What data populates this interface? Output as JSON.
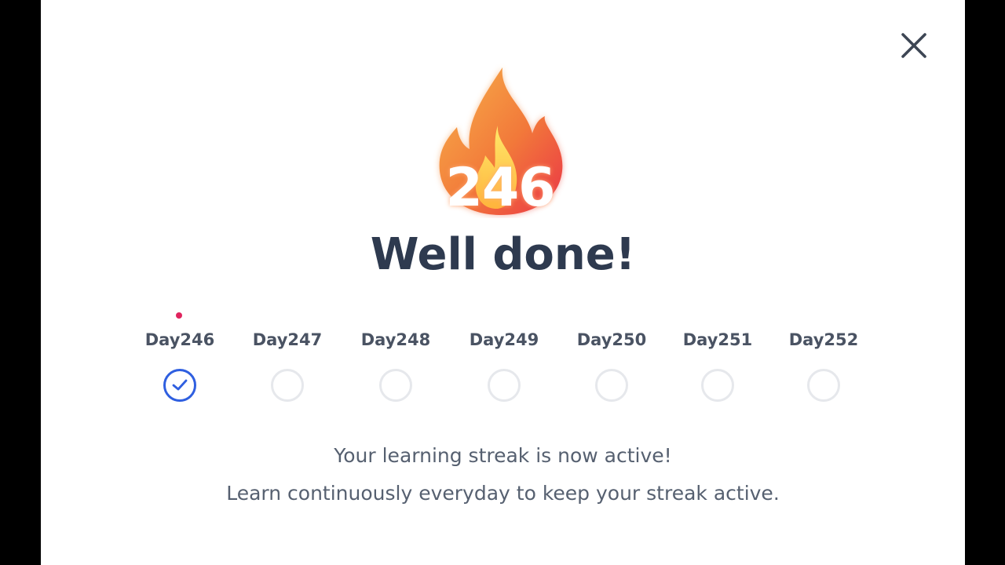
{
  "modal": {
    "streak_count": "246",
    "title": "Well done!",
    "message_line1": "Your learning streak is now active!",
    "message_line2": "Learn continuously everyday to keep your streak active.",
    "close_icon": "close-icon",
    "flame_icon": "flame-icon"
  },
  "days": [
    {
      "label": "Day246",
      "completed": true
    },
    {
      "label": "Day247",
      "completed": false
    },
    {
      "label": "Day248",
      "completed": false
    },
    {
      "label": "Day249",
      "completed": false
    },
    {
      "label": "Day250",
      "completed": false
    },
    {
      "label": "Day251",
      "completed": false
    },
    {
      "label": "Day252",
      "completed": false
    }
  ],
  "colors": {
    "accent": "#2f5fe0",
    "today_dot": "#e0245e",
    "title": "#2e3a4f",
    "flame_outer": "#f0533a",
    "flame_inner": "#ffd84a"
  }
}
